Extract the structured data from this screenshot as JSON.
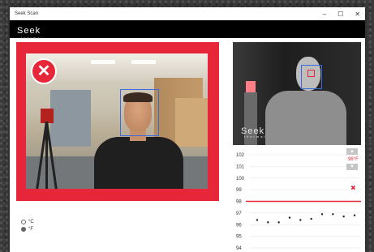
{
  "window": {
    "title": "Seek Scan",
    "controls": {
      "minimize": "–",
      "maximize": "☐",
      "close": "✕"
    }
  },
  "brand": {
    "wordmark": "Seek",
    "tagline": "thermal"
  },
  "camera": {
    "status_icon": "x-icon",
    "status_glyph": "✕",
    "status_color": "#e8263a",
    "frame_color": "#e8263a"
  },
  "thermal_view": {
    "wordmark": "Seek",
    "tagline": "thermal"
  },
  "chart_data": {
    "type": "scatter",
    "y_ticks": [
      "102",
      "101",
      "100",
      "99",
      "98",
      "97",
      "96",
      "95",
      "94"
    ],
    "ylim": [
      94,
      102
    ],
    "threshold": 98,
    "threshold_color": "#e8263a",
    "points": [
      96.4,
      96.2,
      96.2,
      96.6,
      96.4,
      96.5,
      96.9,
      96.9,
      96.7,
      96.8
    ],
    "latest_reading": {
      "label": "98°F",
      "value": 99.2,
      "flag": "✖",
      "color": "#e8263a"
    },
    "grid": true
  },
  "scroll": {
    "up": "▲",
    "down": "▼"
  },
  "units": [
    {
      "label": "°C",
      "selected": false
    },
    {
      "label": "°F",
      "selected": true
    }
  ]
}
